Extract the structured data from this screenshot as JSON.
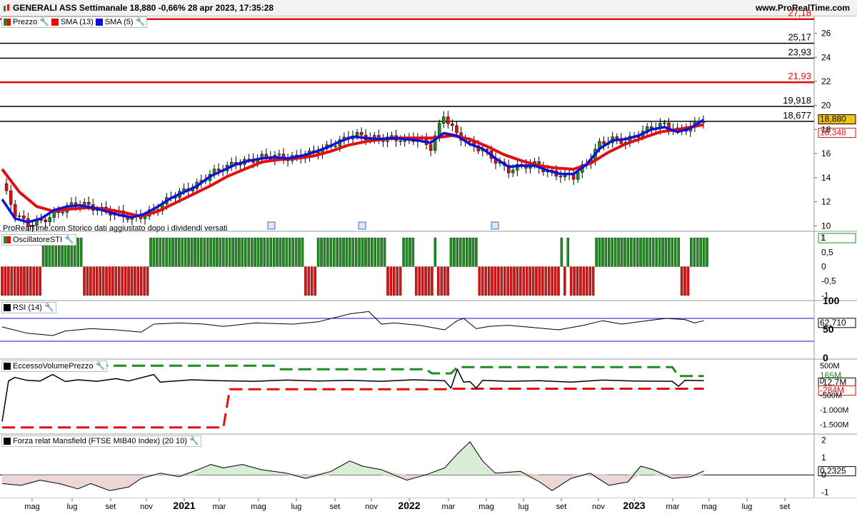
{
  "header": {
    "title": "GENERALI ASS Settimanale 18,880 -0,66% 28 apr 2023, 17:35:28",
    "site": "www.ProRealTime.com"
  },
  "colors": {
    "green": "#1e8c1e",
    "red": "#e01010",
    "blue": "#1010d8",
    "black": "#000000",
    "label_yellow": "#f2c21a"
  },
  "icons": [
    "wrench-icon",
    "calendar-icon"
  ],
  "note": "ProRealTime.com Storico dati aggiustato dopo i dividendi versati",
  "chart_data": [
    {
      "type": "candlestick",
      "panel": "price",
      "legend": [
        {
          "name": "Prezzo"
        },
        {
          "name": "SMA (13)"
        },
        {
          "name": "SMA (5)"
        }
      ],
      "ylim": [
        9.6,
        27.4
      ],
      "yticks": [
        "10",
        "12",
        "14",
        "16",
        "18",
        "20",
        "22",
        "24",
        "26"
      ],
      "horizontal_levels": [
        {
          "label": "27,18",
          "value": 27.18,
          "color": "red"
        },
        {
          "label": "25,17",
          "value": 25.17,
          "color": "black"
        },
        {
          "label": "23,93",
          "value": 23.93,
          "color": "black"
        },
        {
          "label": "21,93",
          "value": 21.93,
          "color": "red"
        },
        {
          "label": "19,918",
          "value": 19.918,
          "color": "black"
        },
        {
          "label": "18,677",
          "value": 18.677,
          "color": "black"
        }
      ],
      "last_price_label": "18,880",
      "sma13_label": "18,348",
      "close_points": [
        [
          0,
          13.5
        ],
        [
          3,
          11.0
        ],
        [
          6,
          10.1
        ],
        [
          9,
          10.4
        ],
        [
          12,
          10.9
        ],
        [
          15,
          11.6
        ],
        [
          18,
          11.9
        ],
        [
          21,
          11.5
        ],
        [
          24,
          11.2
        ],
        [
          27,
          11.0
        ],
        [
          30,
          10.6
        ],
        [
          33,
          10.9
        ],
        [
          36,
          11.5
        ],
        [
          39,
          12.4
        ],
        [
          42,
          12.9
        ],
        [
          45,
          13.4
        ],
        [
          48,
          14.3
        ],
        [
          51,
          14.8
        ],
        [
          54,
          15.2
        ],
        [
          57,
          15.4
        ],
        [
          60,
          15.7
        ],
        [
          63,
          15.8
        ],
        [
          66,
          15.6
        ],
        [
          69,
          15.8
        ],
        [
          72,
          16.1
        ],
        [
          75,
          16.5
        ],
        [
          78,
          17.0
        ],
        [
          81,
          17.6
        ],
        [
          84,
          17.4
        ],
        [
          87,
          17.2
        ],
        [
          90,
          17.3
        ],
        [
          93,
          17.1
        ],
        [
          96,
          17.3
        ],
        [
          99,
          16.5
        ],
        [
          102,
          19.2
        ],
        [
          105,
          17.6
        ],
        [
          108,
          16.8
        ],
        [
          111,
          16.3
        ],
        [
          114,
          15.4
        ],
        [
          117,
          14.6
        ],
        [
          120,
          15.0
        ],
        [
          123,
          15.1
        ],
        [
          126,
          14.5
        ],
        [
          129,
          14.2
        ],
        [
          132,
          14.1
        ],
        [
          135,
          15.2
        ],
        [
          138,
          16.8
        ],
        [
          141,
          17.2
        ],
        [
          144,
          17.0
        ],
        [
          147,
          17.6
        ],
        [
          150,
          18.2
        ],
        [
          153,
          18.4
        ],
        [
          156,
          17.9
        ],
        [
          159,
          18.2
        ],
        [
          162,
          18.9
        ]
      ],
      "sma13_points": [
        [
          0,
          14.7
        ],
        [
          4,
          12.8
        ],
        [
          8,
          11.6
        ],
        [
          12,
          11.2
        ],
        [
          16,
          11.4
        ],
        [
          20,
          11.5
        ],
        [
          24,
          11.4
        ],
        [
          28,
          11.1
        ],
        [
          32,
          10.8
        ],
        [
          36,
          11.2
        ],
        [
          40,
          11.9
        ],
        [
          44,
          12.6
        ],
        [
          48,
          13.3
        ],
        [
          52,
          14.1
        ],
        [
          56,
          14.7
        ],
        [
          60,
          15.3
        ],
        [
          64,
          15.5
        ],
        [
          68,
          15.6
        ],
        [
          72,
          15.8
        ],
        [
          76,
          16.2
        ],
        [
          80,
          16.7
        ],
        [
          84,
          17.0
        ],
        [
          88,
          17.2
        ],
        [
          92,
          17.3
        ],
        [
          96,
          17.3
        ],
        [
          100,
          17.3
        ],
        [
          104,
          17.5
        ],
        [
          108,
          17.2
        ],
        [
          112,
          16.6
        ],
        [
          116,
          15.9
        ],
        [
          120,
          15.4
        ],
        [
          124,
          15.0
        ],
        [
          128,
          14.8
        ],
        [
          132,
          14.7
        ],
        [
          136,
          15.2
        ],
        [
          140,
          16.1
        ],
        [
          144,
          16.8
        ],
        [
          148,
          17.3
        ],
        [
          152,
          17.8
        ],
        [
          156,
          18.0
        ],
        [
          159,
          18.2
        ],
        [
          162,
          18.4
        ]
      ],
      "sma5_points": [
        [
          0,
          12.2
        ],
        [
          3,
          10.6
        ],
        [
          6,
          10.3
        ],
        [
          9,
          10.6
        ],
        [
          12,
          11.3
        ],
        [
          15,
          11.6
        ],
        [
          18,
          11.7
        ],
        [
          21,
          11.5
        ],
        [
          24,
          11.2
        ],
        [
          27,
          10.9
        ],
        [
          30,
          10.7
        ],
        [
          33,
          11.0
        ],
        [
          36,
          11.6
        ],
        [
          39,
          12.3
        ],
        [
          42,
          12.8
        ],
        [
          45,
          13.3
        ],
        [
          48,
          14.1
        ],
        [
          51,
          14.6
        ],
        [
          54,
          15.1
        ],
        [
          57,
          15.4
        ],
        [
          60,
          15.6
        ],
        [
          63,
          15.7
        ],
        [
          66,
          15.6
        ],
        [
          69,
          15.8
        ],
        [
          72,
          16.1
        ],
        [
          75,
          16.5
        ],
        [
          78,
          17.0
        ],
        [
          81,
          17.4
        ],
        [
          84,
          17.3
        ],
        [
          87,
          17.2
        ],
        [
          90,
          17.3
        ],
        [
          93,
          17.2
        ],
        [
          96,
          17.1
        ],
        [
          99,
          16.9
        ],
        [
          102,
          17.7
        ],
        [
          105,
          17.5
        ],
        [
          108,
          16.8
        ],
        [
          111,
          16.4
        ],
        [
          114,
          15.6
        ],
        [
          117,
          14.9
        ],
        [
          120,
          15.0
        ],
        [
          123,
          15.0
        ],
        [
          126,
          14.6
        ],
        [
          129,
          14.3
        ],
        [
          132,
          14.3
        ],
        [
          135,
          15.1
        ],
        [
          138,
          16.4
        ],
        [
          141,
          17.1
        ],
        [
          144,
          17.2
        ],
        [
          147,
          17.5
        ],
        [
          150,
          18.0
        ],
        [
          153,
          18.2
        ],
        [
          156,
          17.8
        ],
        [
          159,
          18.1
        ],
        [
          162,
          18.8
        ]
      ]
    },
    {
      "type": "bar",
      "panel": "OscillatoreSTI",
      "legend": [
        {
          "name": "OscillatoreSTI"
        }
      ],
      "ylim": [
        -1.15,
        1.15
      ],
      "yticks": [
        "1",
        "0,5",
        "0",
        "-0,5",
        "-1"
      ],
      "last_value_label": "1",
      "segments": [
        [
          0,
          -1,
          12
        ],
        [
          13,
          1,
          25
        ],
        [
          26,
          -1,
          46
        ],
        [
          47,
          1,
          95
        ],
        [
          96,
          -1,
          99
        ],
        [
          100,
          1,
          121
        ],
        [
          122,
          -1,
          126
        ],
        [
          127,
          1,
          130
        ],
        [
          131,
          -1,
          136
        ],
        [
          137,
          1,
          137
        ],
        [
          138,
          -1,
          141
        ],
        [
          142,
          1,
          150
        ],
        [
          151,
          -1,
          176
        ],
        [
          177,
          1,
          177
        ],
        [
          178,
          -1,
          178
        ],
        [
          179,
          1,
          179
        ],
        [
          180,
          -1,
          187
        ],
        [
          188,
          1,
          214
        ],
        [
          215,
          -1,
          217
        ],
        [
          218,
          1,
          223
        ]
      ]
    },
    {
      "type": "line",
      "panel": "RSI",
      "legend": [
        {
          "name": "RSI (14)"
        }
      ],
      "ylim": [
        0,
        100
      ],
      "yticks": [
        "100",
        "50",
        "0"
      ],
      "levels": [
        70,
        30
      ],
      "last_value_label": "62,710",
      "points": [
        [
          0,
          55
        ],
        [
          8,
          44
        ],
        [
          16,
          40
        ],
        [
          20,
          48
        ],
        [
          28,
          52
        ],
        [
          36,
          50
        ],
        [
          44,
          46
        ],
        [
          48,
          60
        ],
        [
          56,
          62
        ],
        [
          64,
          60
        ],
        [
          70,
          56
        ],
        [
          80,
          62
        ],
        [
          92,
          60
        ],
        [
          100,
          64
        ],
        [
          110,
          78
        ],
        [
          116,
          82
        ],
        [
          120,
          60
        ],
        [
          124,
          62
        ],
        [
          132,
          58
        ],
        [
          140,
          50
        ],
        [
          144,
          66
        ],
        [
          146,
          70
        ],
        [
          150,
          52
        ],
        [
          154,
          56
        ],
        [
          160,
          58
        ],
        [
          168,
          54
        ],
        [
          176,
          50
        ],
        [
          184,
          58
        ],
        [
          190,
          66
        ],
        [
          196,
          60
        ],
        [
          204,
          66
        ],
        [
          210,
          70
        ],
        [
          216,
          68
        ],
        [
          219,
          62
        ],
        [
          222,
          66
        ]
      ]
    },
    {
      "type": "line",
      "panel": "EccessoVolumePrezzo",
      "legend": [
        {
          "name": "EccessoVolumePrezzo"
        }
      ],
      "ylim": [
        -1800,
        700
      ],
      "yticks": [
        "500M",
        "0",
        "-500M",
        "-1.000M",
        "-1.500M"
      ],
      "labels": [
        "165M",
        "-12,7M",
        "-284M"
      ],
      "upper_band": [
        [
          0,
          500
        ],
        [
          86,
          500
        ],
        [
          88,
          380
        ],
        [
          134,
          380
        ],
        [
          136,
          240
        ],
        [
          142,
          240
        ],
        [
          144,
          450
        ],
        [
          212,
          450
        ],
        [
          214,
          150
        ],
        [
          222,
          150
        ]
      ],
      "lower_band": [
        [
          0,
          -1600
        ],
        [
          70,
          -1600
        ],
        [
          72,
          -300
        ],
        [
          140,
          -300
        ],
        [
          142,
          -284
        ],
        [
          212,
          -284
        ],
        [
          214,
          -284
        ],
        [
          222,
          -284
        ]
      ],
      "points": [
        [
          0,
          -1400
        ],
        [
          2,
          -20
        ],
        [
          4,
          100
        ],
        [
          8,
          0
        ],
        [
          12,
          -20
        ],
        [
          16,
          200
        ],
        [
          20,
          -40
        ],
        [
          24,
          20
        ],
        [
          30,
          -30
        ],
        [
          36,
          60
        ],
        [
          40,
          -20
        ],
        [
          48,
          200
        ],
        [
          50,
          -60
        ],
        [
          60,
          20
        ],
        [
          68,
          -10
        ],
        [
          80,
          -30
        ],
        [
          90,
          10
        ],
        [
          100,
          -20
        ],
        [
          110,
          0
        ],
        [
          120,
          -30
        ],
        [
          130,
          20
        ],
        [
          140,
          -10
        ],
        [
          142,
          -260
        ],
        [
          144,
          380
        ],
        [
          146,
          -60
        ],
        [
          148,
          -40
        ],
        [
          150,
          -260
        ],
        [
          152,
          0
        ],
        [
          160,
          -30
        ],
        [
          170,
          -10
        ],
        [
          180,
          -60
        ],
        [
          190,
          10
        ],
        [
          200,
          -20
        ],
        [
          212,
          -30
        ],
        [
          214,
          -200
        ],
        [
          216,
          0
        ],
        [
          222,
          -12
        ]
      ]
    },
    {
      "type": "area",
      "panel": "Mansfield",
      "legend": [
        {
          "name": "Forza relat Mansfield (FTSE MIB40 Index) (20 10)"
        }
      ],
      "ylim": [
        -1.3,
        2.3
      ],
      "yticks": [
        "2",
        "1",
        "0",
        "-1"
      ],
      "last_value_label": "0,2325",
      "points": [
        [
          0,
          -0.5
        ],
        [
          6,
          -0.6
        ],
        [
          12,
          -0.3
        ],
        [
          18,
          -0.5
        ],
        [
          24,
          -0.8
        ],
        [
          28,
          -0.5
        ],
        [
          34,
          -0.9
        ],
        [
          40,
          -0.7
        ],
        [
          44,
          -0.2
        ],
        [
          50,
          0.1
        ],
        [
          56,
          -0.1
        ],
        [
          62,
          0.3
        ],
        [
          66,
          0.6
        ],
        [
          70,
          0.4
        ],
        [
          76,
          0.6
        ],
        [
          82,
          0.3
        ],
        [
          90,
          0.1
        ],
        [
          96,
          -0.2
        ],
        [
          104,
          0.2
        ],
        [
          110,
          0.8
        ],
        [
          114,
          0.5
        ],
        [
          120,
          0.3
        ],
        [
          128,
          -0.3
        ],
        [
          134,
          0.0
        ],
        [
          140,
          0.4
        ],
        [
          144,
          1.2
        ],
        [
          148,
          1.9
        ],
        [
          152,
          0.8
        ],
        [
          156,
          0.1
        ],
        [
          164,
          0.2
        ],
        [
          170,
          -0.4
        ],
        [
          174,
          -0.9
        ],
        [
          180,
          -0.2
        ],
        [
          186,
          0.1
        ],
        [
          192,
          -0.6
        ],
        [
          198,
          -0.4
        ],
        [
          202,
          0.5
        ],
        [
          206,
          0.3
        ],
        [
          212,
          -0.2
        ],
        [
          218,
          -0.1
        ],
        [
          222,
          0.23
        ]
      ]
    },
    {
      "type": "axis",
      "x_tick_labels": [
        "mag",
        "lug",
        "set",
        "nov",
        "2021",
        "mar",
        "mag",
        "lug",
        "set",
        "nov",
        "2022",
        "mar",
        "mag",
        "lug",
        "set",
        "nov",
        "2023",
        "mar",
        "mag",
        "lug",
        "set"
      ]
    }
  ]
}
